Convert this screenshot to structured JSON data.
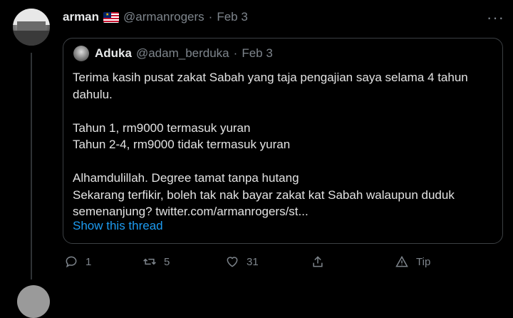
{
  "tweet": {
    "display_name": "arman",
    "handle": "@armanrogers",
    "separator": "·",
    "date": "Feb 3",
    "more_label": "···"
  },
  "quoted": {
    "display_name": "Aduka",
    "handle": "@adam_berduka",
    "separator": "·",
    "date": "Feb 3",
    "lines": [
      "Terima kasih pusat zakat Sabah yang taja pengajian saya selama 4 tahun dahulu.",
      "",
      "Tahun 1, rm9000 termasuk yuran",
      "Tahun 2-4, rm9000 tidak termasuk yuran",
      "",
      "Alhamdulillah. Degree tamat tanpa hutang",
      "Sekarang terfikir, boleh tak nak bayar zakat kat Sabah walaupun duduk semenanjung? twitter.com/armanrogers/st..."
    ],
    "show_thread": "Show this thread"
  },
  "actions": {
    "reply_count": "1",
    "retweet_count": "5",
    "like_count": "31",
    "tip_label": "Tip"
  },
  "colors": {
    "background": "#000000",
    "link": "#1d9bf0",
    "muted": "#7e858c",
    "border": "#3c4044"
  },
  "icons": [
    "reply-icon",
    "retweet-icon",
    "like-icon",
    "share-icon",
    "tip-icon",
    "more-icon",
    "flag-icon"
  ]
}
